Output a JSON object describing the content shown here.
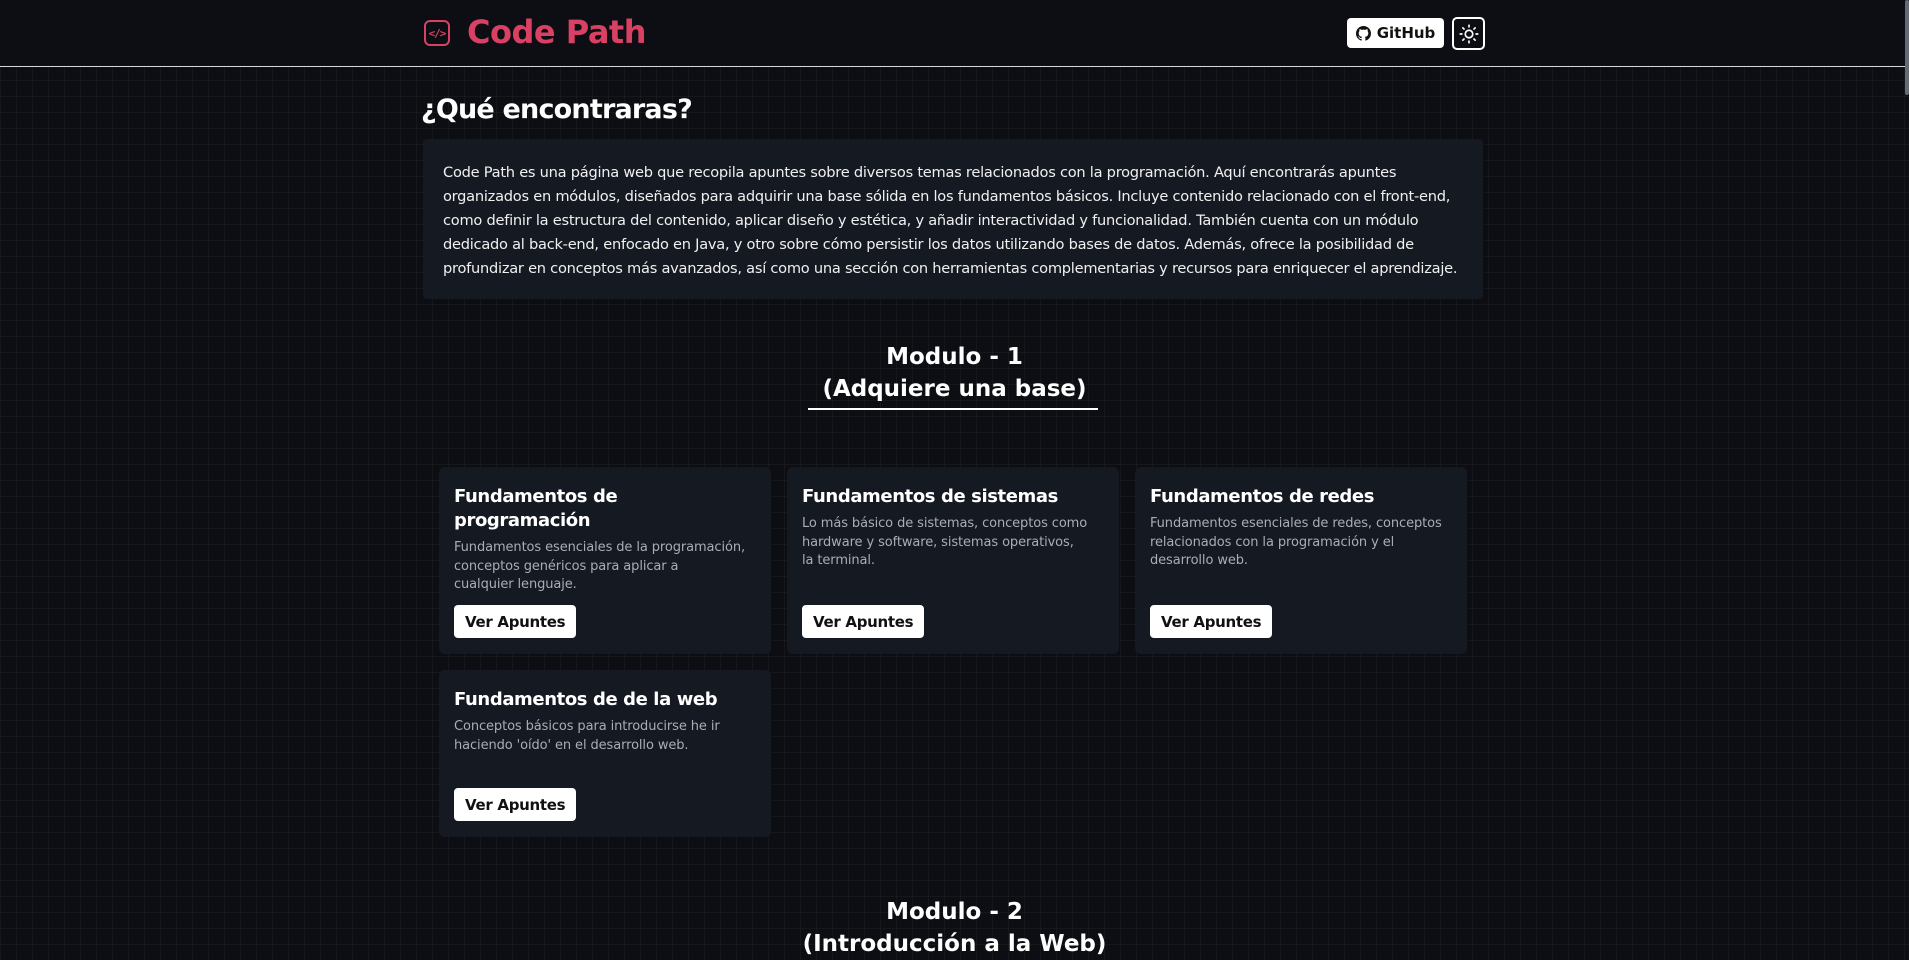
{
  "header": {
    "logo_text": "Code Path",
    "logo_icon": "code-brackets-icon",
    "github_label": "GitHub",
    "theme_toggle_icon": "sun-icon",
    "accent_color": "#d94164"
  },
  "intro": {
    "title": "¿Qué encontraras?",
    "text": "Code Path es una página web que recopila apuntes sobre diversos temas relacionados con la programación. Aquí encontrarás apuntes organizados en módulos, diseñados para adquirir una base sólida en los fundamentos básicos. Incluye contenido relacionado con el front-end, como definir la estructura del contenido, aplicar diseño y estética, y añadir interactividad y funcionalidad. También cuenta con un módulo dedicado al back-end, enfocado en Java, y otro sobre cómo persistir los datos utilizando bases de datos. Además, ofrece la posibilidad de profundizar en conceptos más avanzados, así como una sección con herramientas complementarias y recursos para enriquecer el aprendizaje."
  },
  "modules": [
    {
      "heading_line1": "Modulo - 1",
      "heading_line2": "(Adquiere una base)",
      "cards": [
        {
          "title": "Fundamentos de programación",
          "description": "Fundamentos esenciales de la programación,\nconceptos genéricos para aplicar a\ncualquier lenguaje.",
          "button": "Ver Apuntes"
        },
        {
          "title": "Fundamentos de sistemas",
          "description": "Lo más básico de sistemas, conceptos como\nhardware y software, sistemas operativos,\nla terminal.",
          "button": "Ver Apuntes"
        },
        {
          "title": "Fundamentos de redes",
          "description": "Fundamentos esenciales de redes, conceptos\nrelacionados con la programación y el\ndesarrollo web.",
          "button": "Ver Apuntes"
        },
        {
          "title": "Fundamentos de de la web",
          "description": "Conceptos básicos para introducirse he ir\nhaciendo 'oído' en el desarrollo web.",
          "button": "Ver Apuntes"
        }
      ]
    },
    {
      "heading_line1": "Modulo - 2",
      "heading_line2": "(Introducción a la Web)"
    }
  ]
}
